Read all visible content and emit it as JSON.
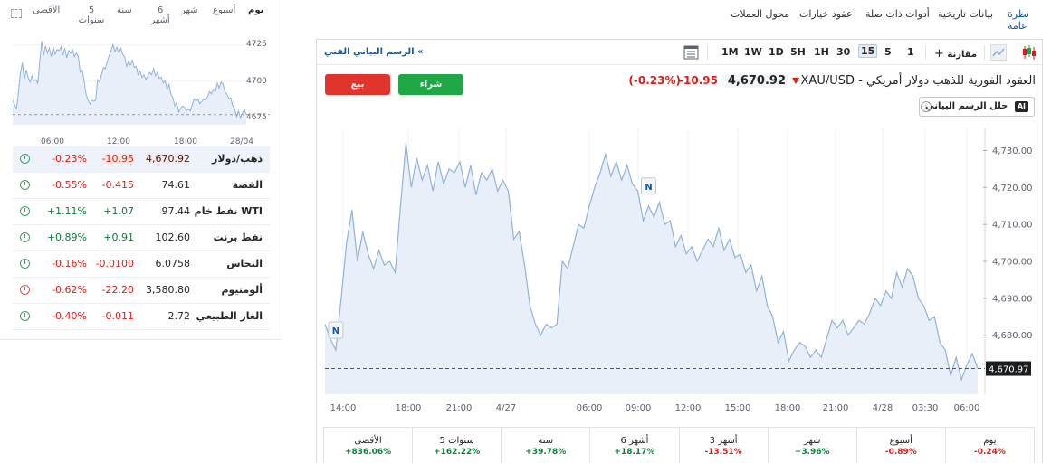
{
  "left_panel": {
    "period_tabs": [
      "يوم",
      "أسبوع",
      "شهر",
      "6 أشهر",
      "سنة",
      "5 سنوات",
      "الأقصى"
    ],
    "mini_chart": {
      "y_ticks": [
        "4725",
        "4700",
        "4675"
      ],
      "x_ticks": [
        "06:00",
        "12:00",
        "18:00",
        "28/04"
      ]
    },
    "quotes": [
      {
        "name": "ذهب/دولار",
        "last": "4,670.92",
        "chg": "-10.95",
        "pct": "-0.23%",
        "dir": "neg",
        "clock": "green"
      },
      {
        "name": "الفضة",
        "last": "74.61",
        "chg": "-0.415",
        "pct": "-0.55%",
        "dir": "neg",
        "clock": "green"
      },
      {
        "name": "نفط خام WTI",
        "last": "97.44",
        "chg": "+1.07",
        "pct": "+1.11%",
        "dir": "pos",
        "clock": "green"
      },
      {
        "name": "نفط برنت",
        "last": "102.60",
        "chg": "+0.91",
        "pct": "+0.89%",
        "dir": "pos",
        "clock": "green"
      },
      {
        "name": "النحاس",
        "last": "6.0758",
        "chg": "-0.0100",
        "pct": "-0.16%",
        "dir": "neg",
        "clock": "green"
      },
      {
        "name": "ألومنيوم",
        "last": "3,580.80",
        "chg": "-22.20",
        "pct": "-0.62%",
        "dir": "neg",
        "clock": "red"
      },
      {
        "name": "الغاز الطبيعي",
        "last": "2.72",
        "chg": "-0.011",
        "pct": "-0.40%",
        "dir": "neg",
        "clock": "green"
      }
    ]
  },
  "nav": {
    "items": [
      "نظرة عامة",
      "بيانات تاريخية",
      "أدوات ذات صلة",
      "عقود خيارات",
      "محول العملات"
    ]
  },
  "toolbar": {
    "tech_chart_link": "الرسم البياني الفني «",
    "compare_label": "مقارنة",
    "intervals": [
      "1",
      "5",
      "15",
      "30",
      "1H",
      "5H",
      "1D",
      "1W",
      "1M"
    ],
    "active_interval": "15"
  },
  "instrument": {
    "title": "XAU/USD - العقود الفورية للذهب دولار أمريكي",
    "price": "4,670.92",
    "change": "-10.95",
    "change_pct": "(-0.23%)",
    "buy_label": "شراء",
    "sell_label": "بيع",
    "ai_label": "حلل الرسم البياني",
    "ai_badge": "AI"
  },
  "chart_data": {
    "type": "area",
    "title": "",
    "x_ticks": [
      "14:00",
      "18:00",
      "21:00",
      "4/27",
      "06:00",
      "09:00",
      "12:00",
      "15:00",
      "18:00",
      "21:00",
      "4/28",
      "03:30",
      "06:00"
    ],
    "y_ticks": [
      "4,730.00",
      "4,720.00",
      "4,710.00",
      "4,700.00",
      "4,690.00",
      "4,680.00"
    ],
    "ylim": [
      4664,
      4736
    ],
    "last_value_label": "4,670.97",
    "last_value": 4670.97,
    "series_color": "#8fb3d9",
    "fill_color": "#e8eff8",
    "markers": [
      "N",
      "N"
    ],
    "values": [
      4683,
      4679,
      4676,
      4690,
      4705,
      4714,
      4700,
      4708,
      4702,
      4698,
      4703,
      4699,
      4700,
      4697,
      4715,
      4732,
      4720,
      4728,
      4722,
      4726,
      4719,
      4727,
      4721,
      4725,
      4724,
      4727,
      4720,
      4726,
      4718,
      4724,
      4722,
      4725,
      4719,
      4722,
      4719,
      4706,
      4708,
      4699,
      4688,
      4683,
      4680,
      4683,
      4682,
      4683,
      4700,
      4698,
      4704,
      4710,
      4709,
      4715,
      4720,
      4724,
      4729,
      4723,
      4727,
      4722,
      4726,
      4721,
      4719,
      4711,
      4715,
      4712,
      4716,
      4710,
      4711,
      4704,
      4707,
      4702,
      4704,
      4700,
      4703,
      4706,
      4704,
      4709,
      4703,
      4706,
      4701,
      4702,
      4697,
      4699,
      4692,
      4696,
      4688,
      4685,
      4678,
      4681,
      4673,
      4676,
      4678,
      4677,
      4674,
      4676,
      4674,
      4679,
      4684,
      4682,
      4684,
      4680,
      4682,
      4684,
      4683,
      4686,
      4690,
      4688,
      4692,
      4690,
      4697,
      4693,
      4698,
      4696,
      4690,
      4688,
      4684,
      4685,
      4678,
      4676,
      4669,
      4674,
      4668,
      4672,
      4675,
      4671
    ]
  },
  "performance": [
    {
      "label": "يوم",
      "value": "-0.24%",
      "dir": "neg"
    },
    {
      "label": "أسبوع",
      "value": "-0.89%",
      "dir": "neg"
    },
    {
      "label": "شهر",
      "value": "+3.96%",
      "dir": "pos"
    },
    {
      "label": "3 أشهر",
      "value": "-13.51%",
      "dir": "neg"
    },
    {
      "label": "6 أشهر",
      "value": "+18.17%",
      "dir": "pos"
    },
    {
      "label": "سنة",
      "value": "+39.78%",
      "dir": "pos"
    },
    {
      "label": "5 سنوات",
      "value": "+162.22%",
      "dir": "pos"
    },
    {
      "label": "الأقصى",
      "value": "+836.06%",
      "dir": "pos"
    }
  ]
}
